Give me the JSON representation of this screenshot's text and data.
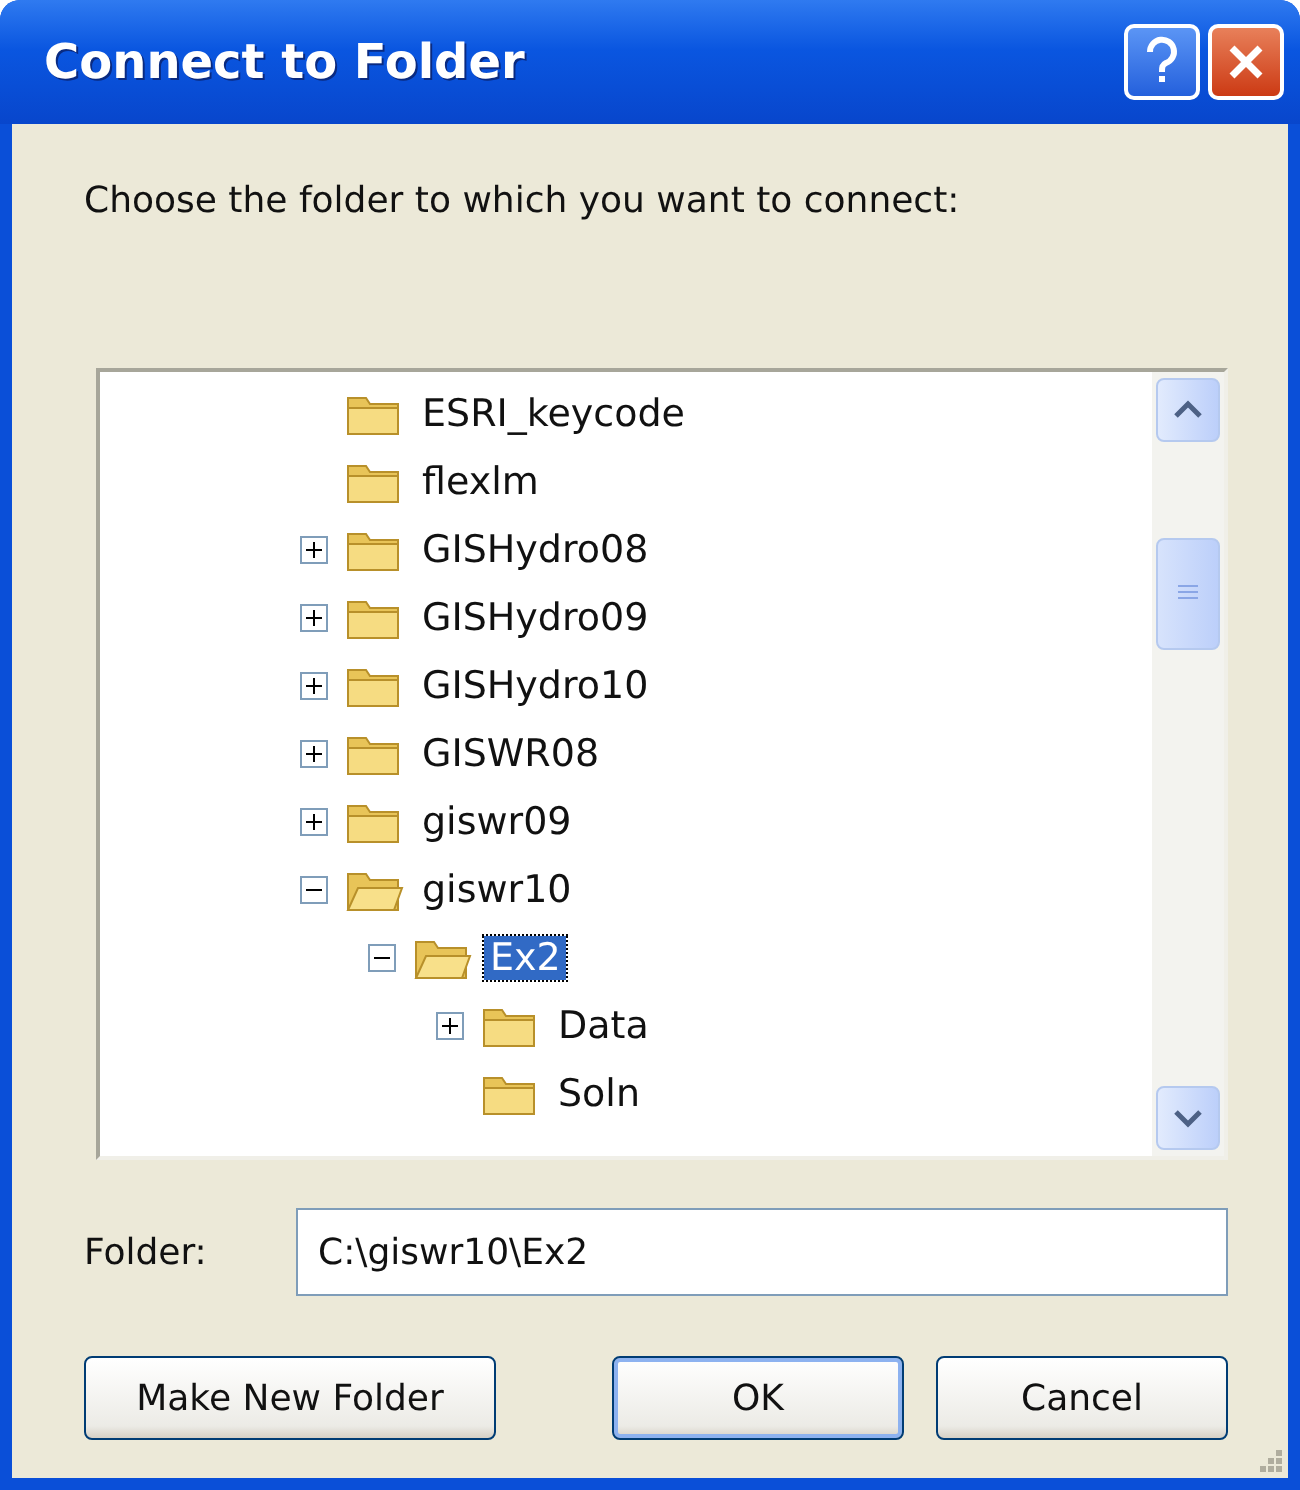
{
  "window": {
    "title": "Connect to Folder"
  },
  "prompt": "Choose the folder to which you want to connect:",
  "tree": [
    {
      "label": "ESRI_keycode",
      "has_children": false,
      "expanded": false,
      "selected": false
    },
    {
      "label": "flexlm",
      "has_children": false,
      "expanded": false,
      "selected": false
    },
    {
      "label": "GISHydro08",
      "has_children": true,
      "expanded": false,
      "selected": false
    },
    {
      "label": "GISHydro09",
      "has_children": true,
      "expanded": false,
      "selected": false
    },
    {
      "label": "GISHydro10",
      "has_children": true,
      "expanded": false,
      "selected": false
    },
    {
      "label": "GISWR08",
      "has_children": true,
      "expanded": false,
      "selected": false
    },
    {
      "label": "giswr09",
      "has_children": true,
      "expanded": false,
      "selected": false
    },
    {
      "label": "giswr10",
      "has_children": true,
      "expanded": true,
      "selected": false,
      "children": [
        {
          "label": "Ex2",
          "has_children": true,
          "expanded": true,
          "selected": true,
          "children": [
            {
              "label": "Data",
              "has_children": true,
              "expanded": false,
              "selected": false
            },
            {
              "label": "Soln",
              "has_children": false,
              "expanded": false,
              "selected": false
            }
          ]
        }
      ]
    }
  ],
  "folder": {
    "label": "Folder:",
    "value": "C:\\giswr10\\Ex2"
  },
  "buttons": [
    {
      "label": "Make New Folder",
      "default": false
    },
    {
      "label": "OK",
      "default": true
    },
    {
      "label": "Cancel",
      "default": false
    }
  ]
}
